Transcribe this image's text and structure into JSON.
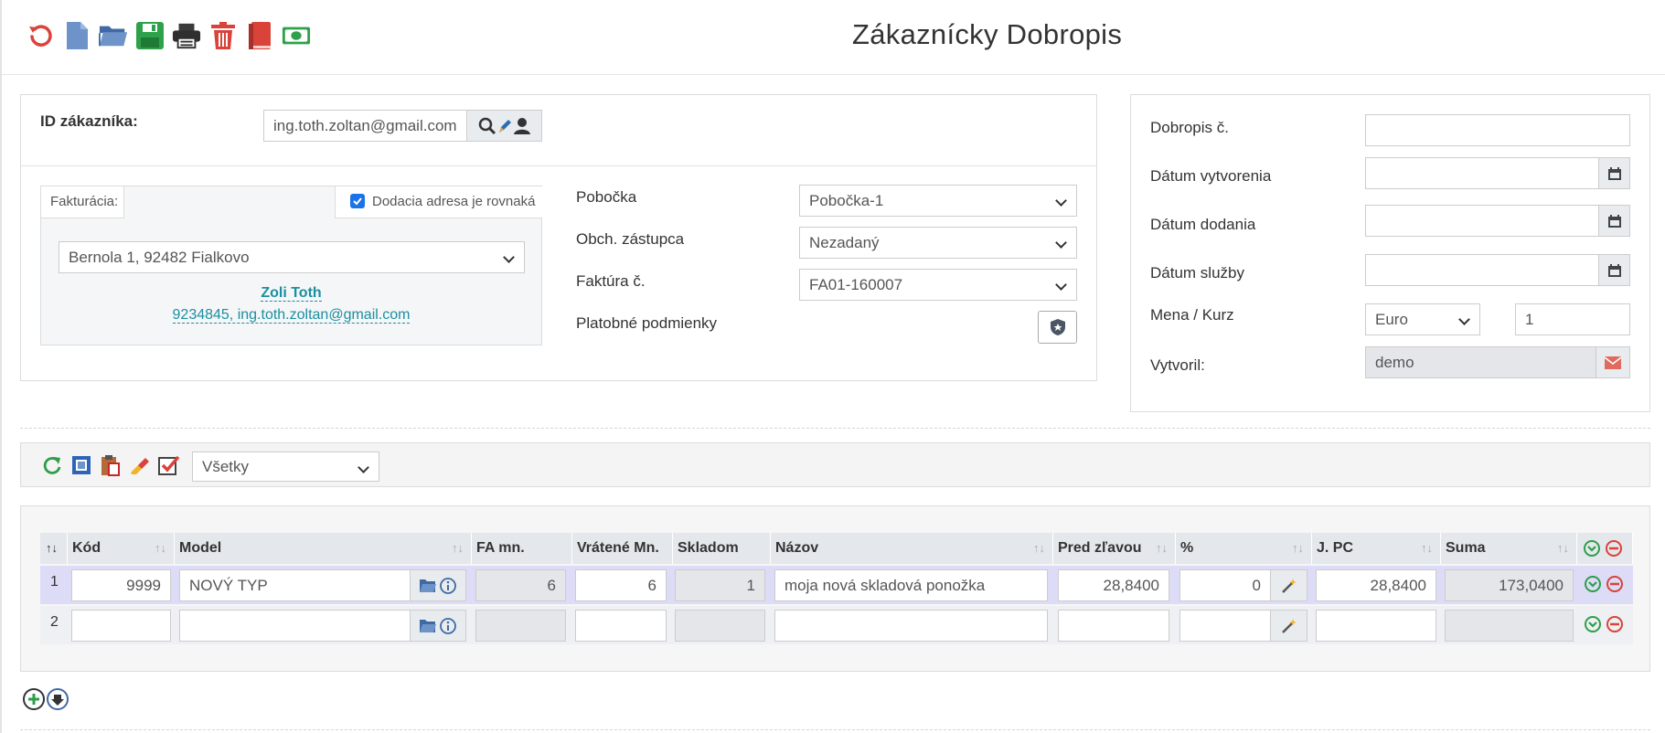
{
  "toolbar": {
    "icons": [
      "refresh-icon",
      "new-document-icon",
      "open-folder-icon",
      "save-icon",
      "print-icon",
      "delete-icon",
      "book-icon",
      "money-icon"
    ]
  },
  "title": "Zákaznícky Dobropis",
  "customer": {
    "id_label": "ID zákazníka:",
    "id_value": "ing.toth.zoltan@gmail.com",
    "billing_tab": "Fakturácia:",
    "same_address_label": "Dodacia adresa je rovnaká",
    "same_address_checked": true,
    "address": "Bernola 1, 92482 Fialkovo",
    "contact_name": "Zoli Toth",
    "contact_details": "9234845, ing.toth.zoltan@gmail.com"
  },
  "details": {
    "branch_label": "Pobočka",
    "branch_value": "Pobočka-1",
    "rep_label": "Obch. zástupca",
    "rep_value": "Nezadaný",
    "invoice_label": "Faktúra č.",
    "invoice_value": "FA01-160007",
    "payment_label": "Platobné podmienky"
  },
  "doc": {
    "number_label": "Dobropis č.",
    "number_value": "",
    "created_label": "Dátum vytvorenia",
    "created_value": "",
    "delivery_label": "Dátum dodania",
    "delivery_value": "",
    "service_label": "Dátum služby",
    "service_value": "",
    "currency_label": "Mena / Kurz",
    "currency_value": "Euro",
    "rate_value": "1",
    "author_label": "Vytvoril:",
    "author_value": "demo"
  },
  "grid_toolbar": {
    "filter_value": "Všetky"
  },
  "grid": {
    "columns": {
      "kod": "Kód",
      "model": "Model",
      "fa_mn": "FA mn.",
      "vratene": "Vrátené Mn.",
      "skladom": "Skladom",
      "nazov": "Názov",
      "pred_zlavou": "Pred zľavou",
      "percent": "%",
      "jpc": "J. PC",
      "suma": "Suma"
    },
    "rows": [
      {
        "num": "1",
        "kod": "9999",
        "model": "NOVÝ TYP",
        "fa_mn": "6",
        "vratene": "6",
        "skladom": "1",
        "nazov": "moja nová skladová ponožka",
        "pred_zlavou": "28,8400",
        "percent": "0",
        "jpc": "28,8400",
        "suma": "173,0400"
      },
      {
        "num": "2",
        "kod": "",
        "model": "",
        "fa_mn": "",
        "vratene": "",
        "skladom": "",
        "nazov": "",
        "pred_zlavou": "",
        "percent": "",
        "jpc": "",
        "suma": ""
      }
    ]
  }
}
